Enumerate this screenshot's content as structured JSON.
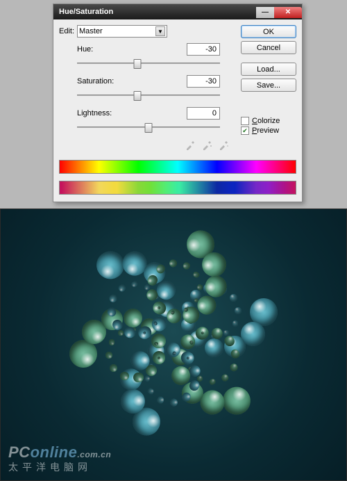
{
  "dialog": {
    "title": "Hue/Saturation",
    "edit_label": "Edit:",
    "edit_value": "Master",
    "sliders": {
      "hue": {
        "label": "Hue:",
        "value": "-30",
        "pos": 42
      },
      "saturation": {
        "label": "Saturation:",
        "value": "-30",
        "pos": 42
      },
      "lightness": {
        "label": "Lightness:",
        "value": "0",
        "pos": 50
      }
    },
    "buttons": {
      "ok": "OK",
      "cancel": "Cancel",
      "load": "Load...",
      "save": "Save..."
    },
    "checks": {
      "colorize": "Colorize",
      "preview": "Preview",
      "colorize_checked": false,
      "preview_checked": true
    }
  },
  "watermark": {
    "brand_left": "PC",
    "brand_right": "online",
    "domain": ".com.cn",
    "cn": "太平洋电脑网"
  }
}
